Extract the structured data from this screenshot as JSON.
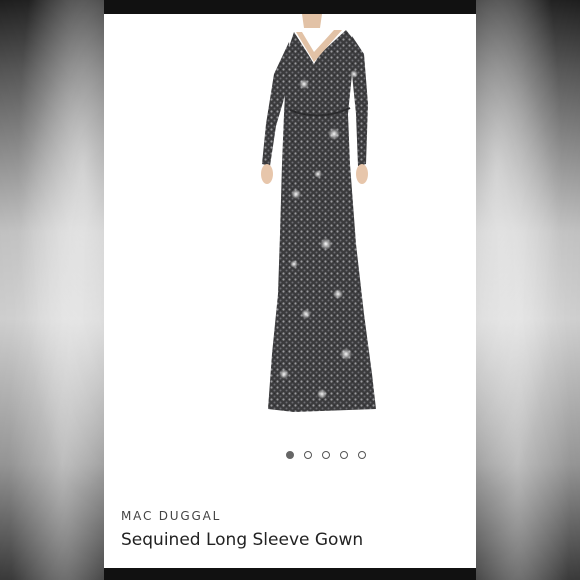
{
  "product": {
    "brand": "MAC DUGGAL",
    "title": "Sequined Long Sleeve Gown",
    "image_icon": "sequined-gown-image"
  },
  "gallery": {
    "dots": [
      {
        "active": true
      },
      {
        "active": false
      },
      {
        "active": false
      },
      {
        "active": false
      },
      {
        "active": false
      }
    ],
    "current_index": 1,
    "total": 5
  },
  "colors": {
    "screen_bg": "#ffffff",
    "bezel": "#111111",
    "dot_active": "#666666"
  }
}
